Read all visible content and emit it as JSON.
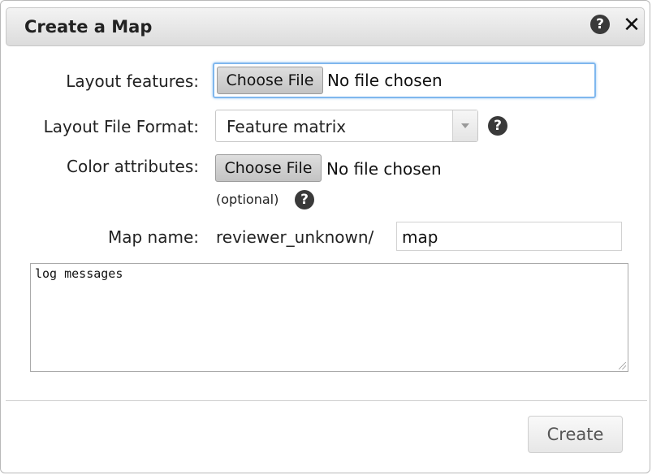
{
  "dialog": {
    "title": "Create a Map",
    "help_icon": "question-circle-icon",
    "close_icon": "close-icon",
    "close_glyph": "✕"
  },
  "form": {
    "layout_features": {
      "label": "Layout features:",
      "button_label": "Choose File",
      "status": "No file chosen"
    },
    "layout_format": {
      "label": "Layout File Format:",
      "selected": "Feature matrix"
    },
    "color_attributes": {
      "label": "Color attributes:",
      "button_label": "Choose File",
      "status": "No file chosen",
      "hint": "(optional)"
    },
    "map_name": {
      "label": "Map name:",
      "prefix": "reviewer_unknown/",
      "value": "map"
    },
    "log": {
      "text": "log messages"
    }
  },
  "footer": {
    "create_label": "Create"
  },
  "help_glyph": "?",
  "colors": {
    "focus_ring": "#7fb7ee",
    "help_circle": "#3a3a3a"
  }
}
